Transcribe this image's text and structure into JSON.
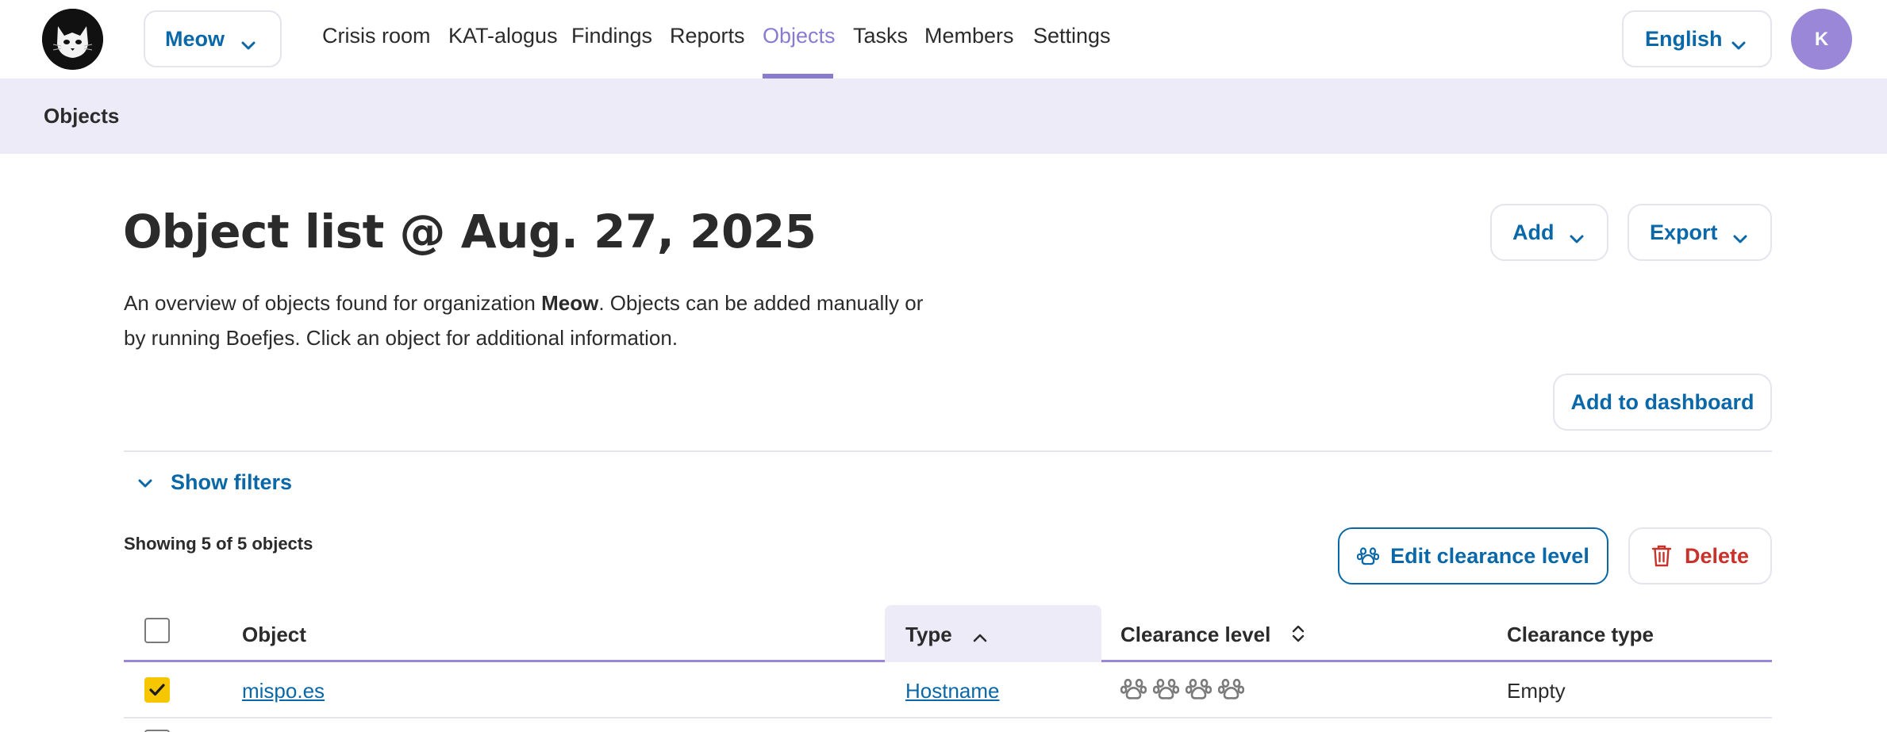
{
  "nav": {
    "org": "Meow",
    "links": [
      "Crisis room",
      "KAT-alogus",
      "Findings",
      "Reports",
      "Objects",
      "Tasks",
      "Members",
      "Settings"
    ],
    "active": "Objects",
    "language": "English",
    "avatar_initial": "K"
  },
  "breadcrumb": {
    "current": "Objects"
  },
  "main": {
    "title": "Object list @ Aug. 27, 2025",
    "intro_before": "An overview of objects found for organization ",
    "intro_org": "Meow",
    "intro_after": ". Objects can be added manually or by running Boefjes. Click an object for additional information.",
    "add_label": "Add",
    "export_label": "Export",
    "add_dashboard_label": "Add to dashboard",
    "show_filters_label": "Show filters",
    "showing_text": "Showing 5 of 5 objects",
    "edit_clearance_label": "Edit clearance level",
    "delete_label": "Delete"
  },
  "table": {
    "headers": {
      "object": "Object",
      "type": "Type",
      "clearance_level": "Clearance level",
      "clearance_type": "Clearance type"
    },
    "rows": [
      {
        "object": "mispo.es",
        "type": "Hostname",
        "clearance_level": 0,
        "clearance_type": "Empty",
        "checked": true
      }
    ]
  },
  "colors": {
    "accent": "#8a7ad0",
    "link": "#0a68a8",
    "delete": "#c8322a",
    "checkbox_checked": "#f6c700",
    "crumb_bg": "#eeebf8"
  }
}
